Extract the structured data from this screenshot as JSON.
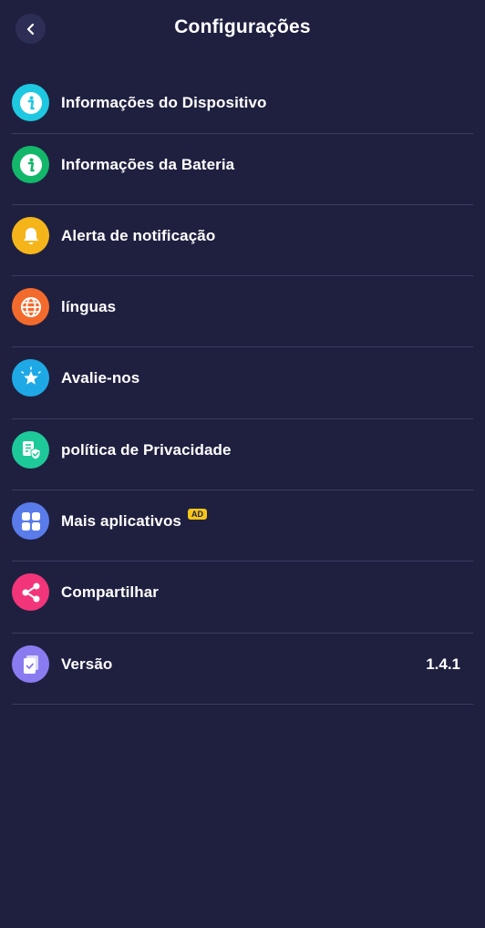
{
  "header": {
    "title": "Configurações",
    "back_icon": "chevron-left-icon"
  },
  "items": [
    {
      "label": "Informações do Dispositivo",
      "icon": "info-icon",
      "color": "#1ec8e0"
    },
    {
      "label": "Informações da Bateria",
      "icon": "info-icon",
      "color": "#13b76a"
    },
    {
      "label": "Alerta de notificação",
      "icon": "bell-icon",
      "color": "#f5b51a"
    },
    {
      "label": "línguas",
      "icon": "globe-icon",
      "color": "#f36b2c"
    },
    {
      "label": "Avalie-nos",
      "icon": "star-icon",
      "color": "#1ea9e6"
    },
    {
      "label": "política de Privacidade",
      "icon": "privacy-shield-icon",
      "color": "#1ec999"
    },
    {
      "label": "Mais aplicativos",
      "icon": "apps-grid-icon",
      "color": "#5a7bea",
      "badge": "AD"
    },
    {
      "label": "Compartilhar",
      "icon": "share-icon",
      "color": "#f2357a"
    },
    {
      "label": "Versão",
      "icon": "version-icon",
      "color": "#8a7cf0",
      "value": "1.4.1"
    }
  ]
}
